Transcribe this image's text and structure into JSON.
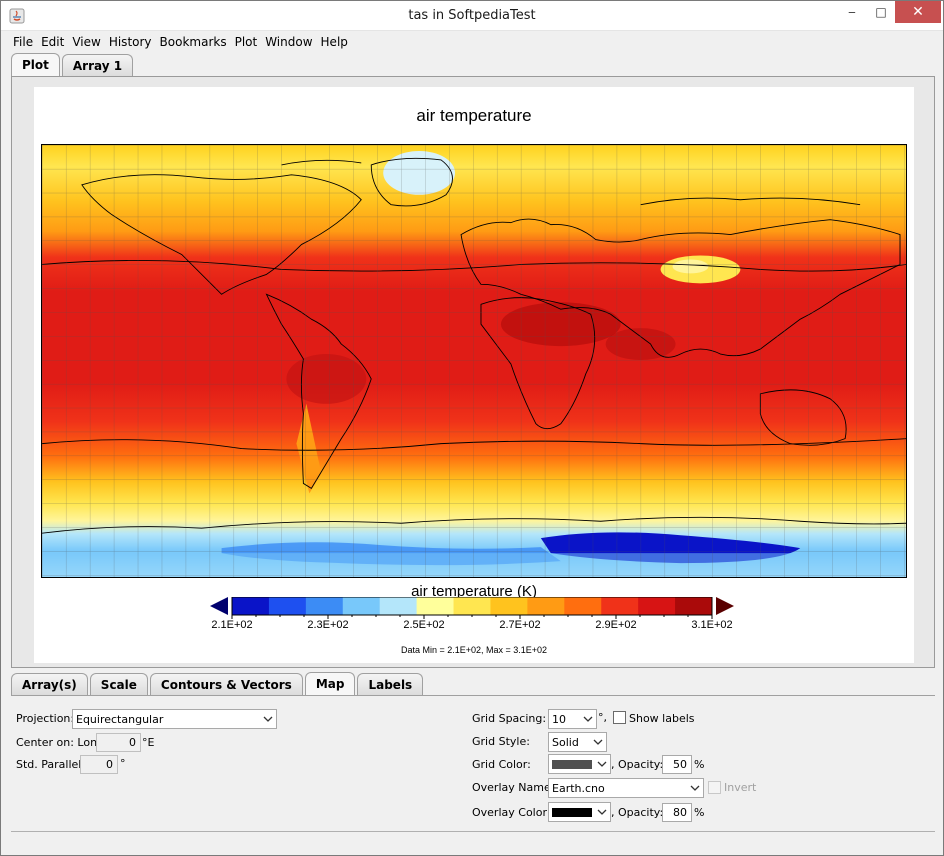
{
  "window": {
    "title": "tas in SoftpediaTest",
    "minimize_glyph": "‒",
    "maximize_glyph": "□",
    "close_glyph": "✕"
  },
  "menu": [
    "File",
    "Edit",
    "View",
    "History",
    "Bookmarks",
    "Plot",
    "Window",
    "Help"
  ],
  "top_tabs": [
    {
      "label": "Plot",
      "active": true
    },
    {
      "label": "Array 1",
      "active": false
    }
  ],
  "plot": {
    "title": "air temperature",
    "colorbar_title": "air temperature (K)",
    "colorbar_ticks": [
      "2.1E+02",
      "2.3E+02",
      "2.5E+02",
      "2.7E+02",
      "2.9E+02",
      "3.1E+02"
    ],
    "colorbar_colors": [
      "#0a14c8",
      "#1e50f0",
      "#3c8cf5",
      "#78c8fa",
      "#b4e6fa",
      "#ffff9b",
      "#ffe650",
      "#ffc31e",
      "#ff9b14",
      "#ff6e0f",
      "#f03219",
      "#d71414",
      "#aa0a0a"
    ],
    "range_text": "Data Min = 2.1E+02, Max = 3.1E+02"
  },
  "bottom_tabs": [
    {
      "label": "Array(s)",
      "active": false
    },
    {
      "label": "Scale",
      "active": false
    },
    {
      "label": "Contours & Vectors",
      "active": false
    },
    {
      "label": "Map",
      "active": true
    },
    {
      "label": "Labels",
      "active": false
    }
  ],
  "map_panel": {
    "projection_label": "Projection:",
    "projection_value": "Equirectangular",
    "center_label": "Center on: Lon.",
    "center_value": "0",
    "center_unit": "°E",
    "parallel_label": "Std. Parallel:",
    "parallel_value": "0",
    "parallel_unit": "°",
    "grid_spacing_label": "Grid Spacing:",
    "grid_spacing_value": "10",
    "grid_spacing_unit": "°,",
    "show_labels": "Show labels",
    "grid_style_label": "Grid Style:",
    "grid_style_value": "Solid",
    "grid_color_label": "Grid Color:",
    "grid_color": "#505050",
    "opacity_label": ", Opacity:",
    "grid_opacity": "50",
    "percent": "%",
    "overlay_name_label": "Overlay Name:",
    "overlay_name_value": "Earth.cno",
    "invert_label": "Invert",
    "overlay_color_label": "Overlay Color:",
    "overlay_color": "#000000",
    "overlay_opacity": "80"
  }
}
